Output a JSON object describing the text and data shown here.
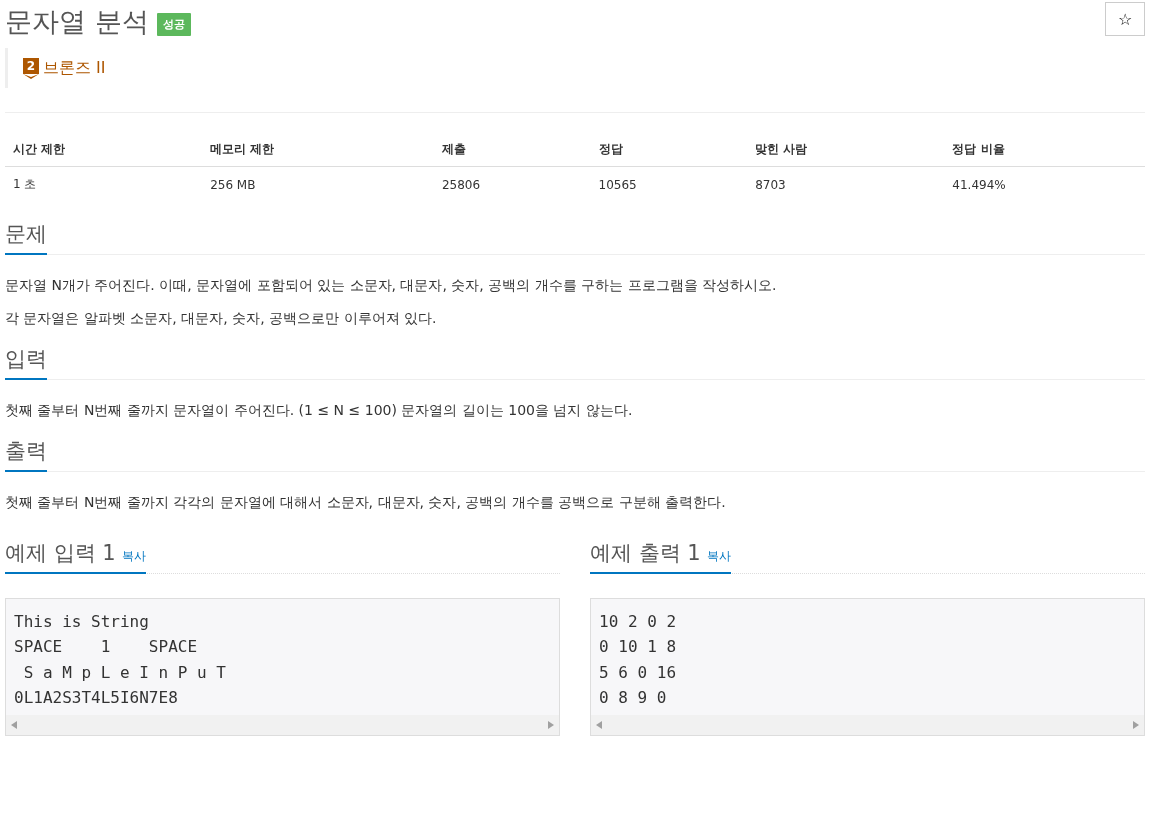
{
  "problem": {
    "title": "문자열 분석",
    "result_badge": "성공",
    "star_button": "☆",
    "tier": {
      "number": "2",
      "label": "브론즈 II"
    }
  },
  "info_table": {
    "columns": [
      "시간 제한",
      "메모리 제한",
      "제출",
      "정답",
      "맞힌 사람",
      "정답 비율"
    ],
    "rows": [
      [
        "1 초",
        "256 MB",
        "25806",
        "10565",
        "8703",
        "41.494%"
      ]
    ]
  },
  "sections": [
    {
      "heading": "문제",
      "paragraphs": [
        "문자열 N개가 주어진다. 이때, 문자열에 포함되어 있는 소문자, 대문자, 숫자, 공백의 개수를 구하는 프로그램을 작성하시오.",
        "각 문자열은 알파벳 소문자, 대문자, 숫자, 공백으로만 이루어져 있다."
      ]
    },
    {
      "heading": "입력",
      "paragraphs": [
        "첫째 줄부터 N번째 줄까지 문자열이 주어진다. (1 ≤ N ≤ 100) 문자열의 길이는 100을 넘지 않는다."
      ]
    },
    {
      "heading": "출력",
      "paragraphs": [
        "첫째 줄부터 N번째 줄까지 각각의 문자열에 대해서 소문자, 대문자, 숫자, 공백의 개수를 공백으로 구분해 출력한다."
      ]
    }
  ],
  "samples": [
    {
      "heading": "예제 입력 1",
      "copy_link": "복사",
      "lines": [
        "This is String",
        "SPACE    1    SPACE",
        " S a M p L e I n P u T",
        "0L1A2S3T4L5I6N7E8"
      ]
    },
    {
      "heading": "예제 출력 1",
      "copy_link": "복사",
      "lines": [
        "10 2 0 2",
        "0 10 1 8",
        "5 6 0 16",
        "0 8 9 0"
      ]
    }
  ]
}
